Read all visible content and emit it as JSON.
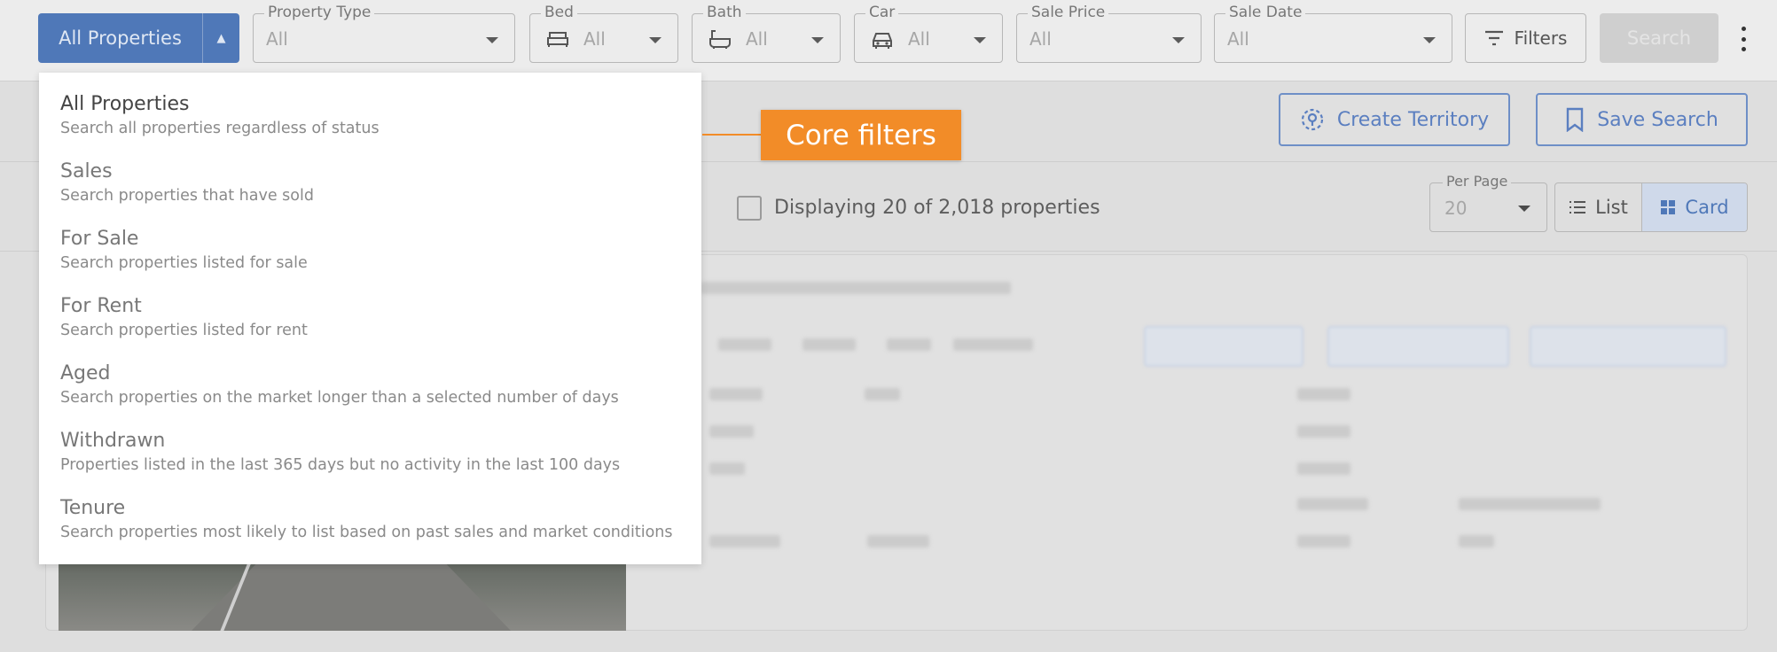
{
  "topbar": {
    "scope_button": {
      "label": "All Properties"
    },
    "property_type": {
      "label": "Property Type",
      "value": "All"
    },
    "bed": {
      "label": "Bed",
      "value": "All",
      "icon": "bed-icon"
    },
    "bath": {
      "label": "Bath",
      "value": "All",
      "icon": "bath-icon"
    },
    "car": {
      "label": "Car",
      "value": "All",
      "icon": "car-icon"
    },
    "sale_price": {
      "label": "Sale Price",
      "value": "All"
    },
    "sale_date": {
      "label": "Sale Date",
      "value": "All"
    },
    "filters_label": "Filters",
    "search_label": "Search"
  },
  "actions": {
    "create_territory": "Create Territory",
    "save_search": "Save Search"
  },
  "results": {
    "displaying_text": "Displaying 20 of 2,018 properties",
    "per_page_label": "Per Page",
    "per_page_value": "20",
    "view_list": "List",
    "view_card": "Card"
  },
  "menu": {
    "items": [
      {
        "title": "All Properties",
        "description": "Search all properties regardless of status"
      },
      {
        "title": "Sales",
        "description": "Search properties that have sold"
      },
      {
        "title": "For Sale",
        "description": "Search properties listed for sale"
      },
      {
        "title": "For Rent",
        "description": "Search properties listed for rent"
      },
      {
        "title": "Aged",
        "description": "Search properties on the market longer than a selected number of days"
      },
      {
        "title": "Withdrawn",
        "description": "Properties listed in the last 365 days but no activity in the last 100 days"
      },
      {
        "title": "Tenure",
        "description": "Search properties most likely to list based on past sales and market conditions"
      }
    ]
  },
  "annotation": {
    "label": "Core filters"
  },
  "colors": {
    "accent": "#f28c28",
    "primary": "#4f78b8"
  }
}
